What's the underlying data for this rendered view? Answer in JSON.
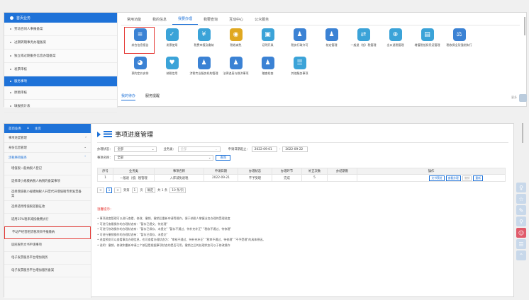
{
  "top": {
    "sidebar": {
      "header": "首页业务",
      "items": [
        "劳动合同人事报备案",
        "过期转期事务办理备案",
        "独立或过期服务信息办理备案",
        "发票审核"
      ],
      "section2": "服务事项",
      "items2": [
        "原稿审核",
        "填报统计表"
      ]
    },
    "tabs": [
      "常用功能",
      "我的信息",
      "我要办理",
      "我要查询",
      "互动中心",
      "公众服务"
    ],
    "active_tab": "我要办理",
    "icons_row1": [
      {
        "label": "综合信息报告",
        "color": "#3b82d4",
        "glyph": "≡"
      },
      {
        "label": "发票使用",
        "color": "#3ba3d8",
        "glyph": "✓"
      },
      {
        "label": "税费申报及缴纳",
        "color": "#3ba3d8",
        "glyph": "¥"
      },
      {
        "label": "税收减免",
        "color": "#e0a820",
        "glyph": "◉"
      },
      {
        "label": "证明开具",
        "color": "#3ba3d8",
        "glyph": "▣"
      },
      {
        "label": "税务行政许可",
        "color": "#3b82d4",
        "glyph": "♟"
      },
      {
        "label": "核定管理",
        "color": "#3b82d4",
        "glyph": "♟"
      },
      {
        "label": "一般退（抵）税管理",
        "color": "#3ba3d8",
        "glyph": "⇄"
      },
      {
        "label": "出口退税管理",
        "color": "#3ba3d8",
        "glyph": "⊕"
      },
      {
        "label": "增值税抵扣凭证管理",
        "color": "#3ba3d8",
        "glyph": "▤"
      },
      {
        "label": "税收保全及强制执行",
        "color": "#3b82d4",
        "glyph": "⚖"
      }
    ],
    "icons_row2": [
      {
        "label": "预约定价安排",
        "color": "#3b82d4",
        "glyph": "◕"
      },
      {
        "label": "纳税信用",
        "color": "#3ba3d8",
        "glyph": "♥"
      },
      {
        "label": "涉税专业服务机构管理",
        "color": "#3b82d4",
        "glyph": "♟"
      },
      {
        "label": "法律追责与救济事项",
        "color": "#3b82d4",
        "glyph": "♟"
      },
      {
        "label": "稽查检查",
        "color": "#3b82d4",
        "glyph": "♟"
      },
      {
        "label": "其他服务事项",
        "color": "#3ba3d8",
        "glyph": "☰"
      }
    ],
    "sub_tabs": [
      "我的待办",
      "服务提醒"
    ],
    "more": "更多"
  },
  "bottom": {
    "sidebar": {
      "header": "首页业务",
      "header_right": "主页",
      "items": [
        {
          "label": "事项进度管理",
          "type": "item"
        },
        {
          "label": "身份信息管理",
          "type": "item"
        },
        {
          "label": "涉税事项服务",
          "type": "item-blue"
        }
      ],
      "subs": [
        "增值税一般纳税人登记",
        "选择转小规模纳税人纳税的备案事项",
        "选择增值税小规模纳税人开票代开增值税专用发票备案",
        "选择适用增值税差额征收",
        "适用15%税率减按缴费执行",
        "不动产经营租赁税项目申报缴纳",
        "居民税务文书申请事项",
        "电子发票服务平台增加税务",
        "电子发票服务平台增加服务备案"
      ],
      "selected_index": 5
    },
    "title": "事项进度管理",
    "filters": {
      "status_label": "办理状态：",
      "status_value": "全部",
      "type_label": "业务类：",
      "type_placeholder": "全部",
      "date_label": "申请日期起止：",
      "date_from": "2022-09-01",
      "date_sep": "-",
      "date_to": "2022-09-22",
      "name_label": "事项名称：",
      "name_value": "全部",
      "query": "查询"
    },
    "table": {
      "headers": [
        "序号",
        "业务类",
        "事项名称",
        "申请日期",
        "办理状态",
        "办理环节",
        "补正次数",
        "办结期限",
        "操作"
      ],
      "rows": [
        {
          "no": "1",
          "cat": "一般退（抵）税管理",
          "name": "入库减免退税",
          "date": "2022-09-21",
          "status": "不予受理",
          "step": "完成",
          "count": "5",
          "deadline": ""
        }
      ],
      "ops": [
        "文书预览",
        "查看办理",
        "撤销",
        "重新"
      ]
    },
    "pager": {
      "prev": "<",
      "page": "1",
      "next": ">",
      "goto": "到第",
      "page_input": "1",
      "page_unit": "页",
      "confirm": "确定",
      "total": "共 1 条",
      "per_page": "10 条/页"
    },
    "tips_title": "温馨提示：",
    "tips": [
      "事项进度管理可以进行查看、修改、撤销、撤销后重新申请等操作，便于纳税人掌握业务办理的受理进度",
      "可进行查看操作的办理状态有：\"暂存已提交、待处理\"",
      "可进行修改操作的办理状态有：\"暂存已保存、未提交\" \"暂存不通过、待补充补正\" \"税收不通过、待修理\"",
      "可进行撤销操作的办理状态有：\"暂存已保存、未提交\"",
      "进度预览可以查看事务办理信息，也可查看办理状态为：\"审核不通过、待补充补正\" \"税审不通过、待修理\" \"不予受理\"的具体原因。",
      "说明：撤销、修改和重新申请三个按钮是根据事项状态的是否可用，撤销之后的处理状态可以于修改操作"
    ]
  }
}
